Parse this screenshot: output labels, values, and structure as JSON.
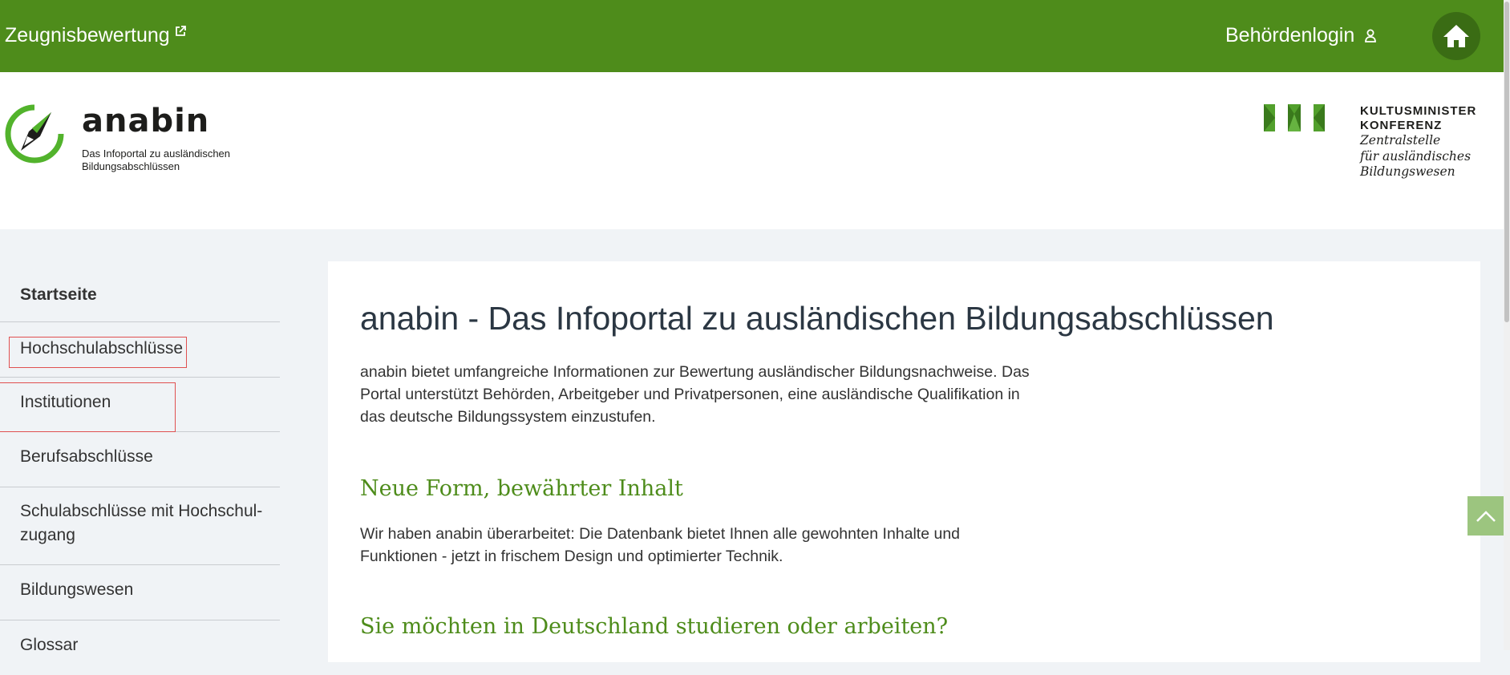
{
  "topbar": {
    "zeugnis_label": "Zeugnisbewertung",
    "login_label": "Behördenlogin",
    "external_icon": "external-link-icon",
    "user_icon": "user-icon",
    "home_icon": "home-icon",
    "color": "#4e8c1b"
  },
  "header": {
    "logo_word": "anabin",
    "logo_sub_1": "Das Infoportal zu ausländischen",
    "logo_sub_2": "Bildungsabschlüssen",
    "kmk_line_1": "KULTUSMINISTER",
    "kmk_line_2": "KONFERENZ",
    "kmk_line_3": "Zentralstelle",
    "kmk_line_4": "für ausländisches",
    "kmk_line_5": "Bildungswesen"
  },
  "sidebar": {
    "items": [
      {
        "label": "Startseite"
      },
      {
        "label": "Hochschulabschlüsse"
      },
      {
        "label": "Institutionen"
      },
      {
        "label": "Berufsabschlüsse"
      },
      {
        "label": "Schulabschlüsse mit Hochschul-"
      },
      {
        "label": "zugang"
      },
      {
        "label": "Bildungswesen"
      },
      {
        "label": "Glossar"
      }
    ]
  },
  "main": {
    "title": "anabin - Das Infoportal zu ausländischen Bildungsabschlüssen",
    "intro_1": "anabin bietet umfangreiche Informationen zur Bewertung ausländischer Bildungsnachweise. Das",
    "intro_2": "Portal unterstützt Behörden, Arbeitgeber und Privatpersonen, eine ausländische Qualifikation in",
    "intro_3": "das deutsche Bildungssystem einzustufen.",
    "h2_1": "Neue Form, bewährter Inhalt",
    "p2_1": "Wir haben anabin überarbeitet: Die Datenbank bietet Ihnen alle gewohnten Inhalte und",
    "p2_2": "Funktionen - jetzt in frischem Design und optimierter Technik.",
    "h2_2": "Sie möchten in Deutschland studieren oder arbeiten?"
  },
  "scroll_top_icon": "chevron-up-icon"
}
